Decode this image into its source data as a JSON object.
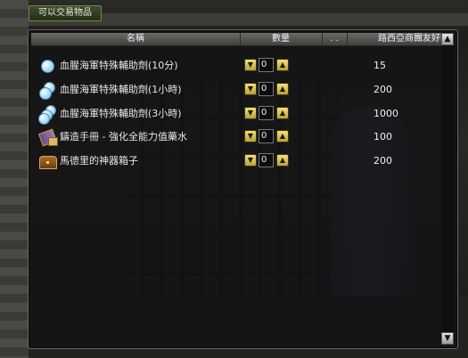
{
  "tab": {
    "label": "可以交易物品"
  },
  "columns": {
    "name": "名稱",
    "quantity": "數量",
    "more": ". .",
    "price": "路西亞商團友好"
  },
  "items": [
    {
      "name": "血腥海軍特殊輔助劑(10分)",
      "icon": "potion-icon",
      "quantity": "0",
      "price": "15"
    },
    {
      "name": "血腥海軍特殊輔助劑(1小時)",
      "icon": "potion-stack-icon",
      "quantity": "0",
      "price": "200"
    },
    {
      "name": "血腥海軍特殊輔助劑(3小時)",
      "icon": "potion-stack-large-icon",
      "quantity": "0",
      "price": "1000"
    },
    {
      "name": "鑄造手冊 - 強化全能力值藥水",
      "icon": "crafting-manual-icon",
      "quantity": "0",
      "price": "100"
    },
    {
      "name": "馬德里的神器箱子",
      "icon": "treasure-chest-icon",
      "quantity": "0",
      "price": "200"
    }
  ],
  "buttons": {
    "decrease": "▼",
    "increase": "▲",
    "scroll_up": "▲",
    "scroll_down": "▼"
  }
}
